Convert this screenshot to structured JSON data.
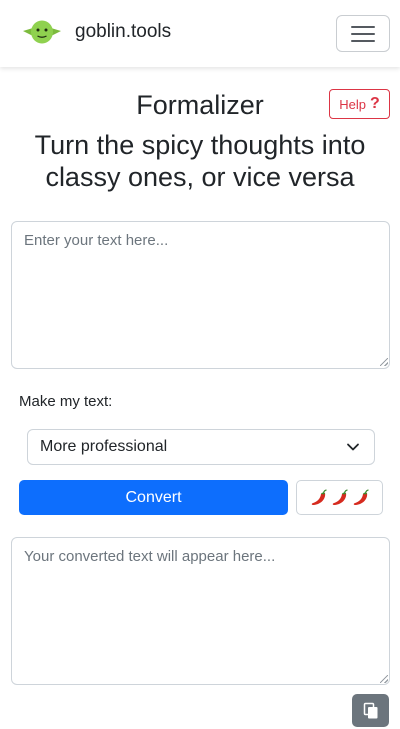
{
  "nav": {
    "brand": "goblin.tools",
    "menu_icon": "hamburger-icon"
  },
  "header": {
    "title": "Formalizer",
    "help_label": "Help",
    "help_icon": "question-icon",
    "subtitle": "Turn the spicy thoughts into classy ones, or vice versa"
  },
  "input": {
    "placeholder": "Enter your text here...",
    "value": ""
  },
  "options": {
    "label": "Make my text:",
    "selected": "More professional"
  },
  "actions": {
    "convert_label": "Convert",
    "spiciness_icon": "chili-pepper-icon",
    "copy_icon": "clipboard-icon"
  },
  "output": {
    "placeholder": "Your converted text will appear here...",
    "value": ""
  },
  "colors": {
    "primary": "#0d6efd",
    "danger": "#dc3545",
    "secondary": "#6c757d",
    "goblin_green": "#8fd14f"
  }
}
